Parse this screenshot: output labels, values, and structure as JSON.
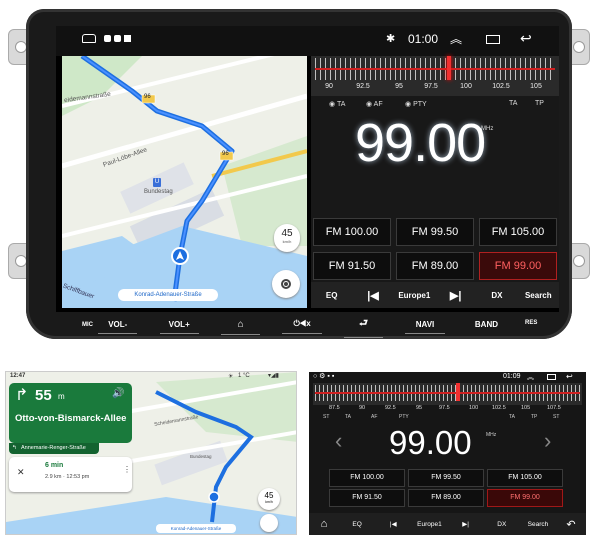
{
  "hardware_buttons": [
    "MIC",
    "VOL-",
    "VOL+",
    "⌂",
    "⏻◀x",
    "⮐",
    "NAVI",
    "BAND",
    "RES"
  ],
  "status": {
    "time": "01:00"
  },
  "map": {
    "streets": [
      "eidemannstraße",
      "Paul-Löbe-Allee",
      "Bundestag",
      "Schiffbauer",
      "96",
      "96"
    ],
    "zoom_speed": "45",
    "zoom_unit": "km/h",
    "street_pill": "Konrad-Adenauer-Straße"
  },
  "radio": {
    "scale_labels": [
      "90",
      "92.5",
      "95",
      "97.5",
      "100",
      "102.5",
      "105"
    ],
    "rds_left": [
      "TA",
      "AF",
      "PTY"
    ],
    "rds_right": [
      "TA",
      "TP"
    ],
    "frequency": "99.00",
    "unit": "MHz",
    "presets": [
      "FM 100.00",
      "FM  99.50",
      "FM 105.00",
      "FM 91.50",
      "FM  89.00",
      "FM 99.00"
    ],
    "active_preset": 5,
    "controls": [
      "EQ",
      "|◀",
      "Europe1",
      "▶|",
      "DX",
      "Search"
    ]
  },
  "thumb_nav": {
    "time": "12:47",
    "temp": "1 °C",
    "distance": "55",
    "distance_unit": "m",
    "street": "Otto-von-Bismarck-Allee",
    "next_street": "Annemarie-Renger-Straße",
    "eta_min": "6 min",
    "eta_detail": "2.9 km · 12:53 pm",
    "map_pill": "Konrad-Adenauer-Straße",
    "zoom_speed": "45",
    "zoom_unit": "km/h",
    "map_labels": [
      "Scheidemannstraße",
      "Bundestag"
    ]
  },
  "thumb_radio": {
    "time": "01:09",
    "scale_labels": [
      "87.5",
      "90",
      "92.5",
      "95",
      "97.5",
      "100",
      "102.5",
      "105",
      "107.5"
    ],
    "rds_left": [
      "ST",
      "TA",
      "AF",
      "PTY"
    ],
    "rds_right": [
      "TA",
      "TP",
      "ST"
    ],
    "frequency": "99.00",
    "unit": "MHz",
    "presets": [
      "FM  100.00",
      "FM  99.50",
      "FM  105.00",
      "FM  91.50",
      "FM  89.00",
      "FM  99.00"
    ],
    "controls": [
      "EQ",
      "|◀",
      "Europe1",
      "▶|",
      "DX",
      "Search"
    ]
  }
}
